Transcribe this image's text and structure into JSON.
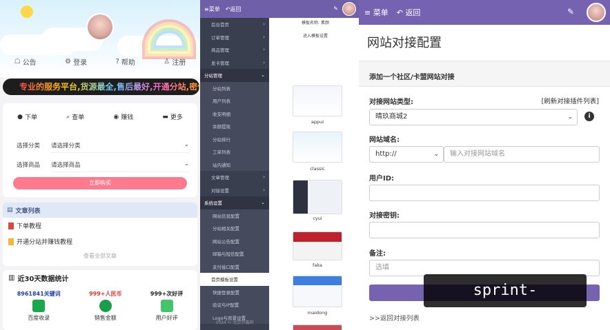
{
  "panel1": {
    "nav": [
      "公告",
      "登录",
      "帮助",
      "注册"
    ],
    "marquee": "专业的服务平台,货源最全,售后最好,开通分站,密价",
    "tabs": [
      "下单",
      "查单",
      "赚钱",
      "更多"
    ],
    "category_label": "选择分类",
    "category_placeholder": "请选择分类",
    "product_label": "选择商品",
    "product_placeholder": "请选择商品",
    "order_button": "立即购买",
    "articles_title": "文章列表",
    "articles": [
      "下单教程",
      "开通分站并赚钱教程"
    ],
    "articles_more": "查看全部文章",
    "stats_title": "近30天数据统计",
    "stats": [
      {
        "value": "8961841关键词",
        "label": "百度收录",
        "color": "#1f3fb0"
      },
      {
        "value": "999+人民币",
        "label": "销售金额",
        "color": "#e53935"
      },
      {
        "value": "999+次好评",
        "label": "用户好评",
        "color": "#222222"
      }
    ]
  },
  "panel2": {
    "menu_label": "菜单",
    "back_label": "返回",
    "menu": [
      {
        "label": "后台首页",
        "type": "item"
      },
      {
        "label": "订单管理",
        "type": "item"
      },
      {
        "label": "商品管理",
        "type": "item"
      },
      {
        "label": "发卡管理",
        "type": "item"
      },
      {
        "label": "分站管理",
        "type": "grp"
      },
      {
        "label": "分站列表",
        "type": "sub"
      },
      {
        "label": "用户列表",
        "type": "sub"
      },
      {
        "label": "收支明细",
        "type": "sub"
      },
      {
        "label": "余额提现",
        "type": "sub"
      },
      {
        "label": "分站排行",
        "type": "sub"
      },
      {
        "label": "工单列表",
        "type": "sub"
      },
      {
        "label": "站内通知",
        "type": "sub"
      },
      {
        "label": "文章管理",
        "type": "item"
      },
      {
        "label": "对接设置",
        "type": "item"
      },
      {
        "label": "系统设置",
        "type": "grp"
      },
      {
        "label": "网站信息配置",
        "type": "sub"
      },
      {
        "label": "分站相关配置",
        "type": "sub"
      },
      {
        "label": "网站公告配置",
        "type": "sub"
      },
      {
        "label": "邮箱与短信配置",
        "type": "sub"
      },
      {
        "label": "支付接口配置",
        "type": "sub"
      },
      {
        "label": "首页模板设置",
        "type": "act"
      },
      {
        "label": "快捷登录配置",
        "type": "sub"
      },
      {
        "label": "验证与IP配置",
        "type": "sub"
      },
      {
        "label": "Logo与背景设置",
        "type": "sub"
      }
    ],
    "footer": "2024 © 北京宗鑫研",
    "template_name_label": "模板名称: 素颜",
    "enter_template": "进入模板设置",
    "templates": [
      "appui",
      "classic",
      "cyui",
      "faka",
      "maidong"
    ]
  },
  "panel3": {
    "menu_label": "菜单",
    "back_label": "返回",
    "page_title": "网站对接配置",
    "section_title": "添加一个社区/卡盟网站对接",
    "type_label": "对接网站类型:",
    "refresh_link": "[刷新对接插件列表]",
    "type_value": "晴玖商城2",
    "domain_label": "网站域名:",
    "protocol": "http://",
    "domain_placeholder": "输入对接网站域名",
    "user_label": "用户ID:",
    "key_label": "对接密钥:",
    "note_label": "备注:",
    "note_placeholder": "选填",
    "back_link": ">>返回对接列表"
  },
  "watermark": "sprint-infinity.com"
}
